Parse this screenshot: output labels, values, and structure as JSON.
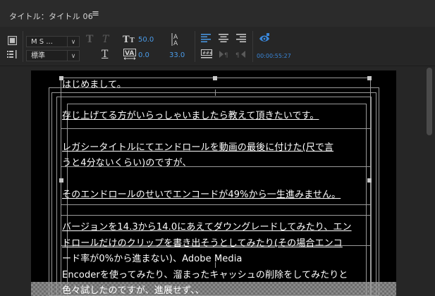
{
  "window": {
    "title": "タイトル：タイトル 06",
    "menu_glyph": "≡"
  },
  "toolbar": {
    "font_name": "M S ...",
    "font_style": "標準",
    "font_size": "50.0",
    "kerning": "0.0",
    "leading": "33.0",
    "timecode": "00:00:55:27",
    "text_T_bold": "T",
    "text_T_italic": "T",
    "text_T_plain": "T"
  },
  "colors": {
    "accent": "#3a86d8",
    "canvas": "#000000",
    "panel": "#262626"
  },
  "text_lines": [
    "はじめまして。",
    "存じ上げてる方がいらっしゃいましたら教えて頂きたいです。",
    "レガシータイトルにてエンドロールを動画の最後に付けた(尺で言",
    "うと4分ないくらい)のですが、",
    "そのエンドロールのせいでエンコードが49%から一生進みません。",
    "バージョンを14.3から14.0にあえてダウングレードしてみたり、エン",
    "ドロールだけのクリップを書き出そうとしてみたり(その場合エンコ",
    "ード率が0%から進まない)、Adobe Media",
    "Encoderを使ってみたり、溜まったキャッシュの削除をしてみたりと",
    "色々試したのですが、進展せず、、"
  ]
}
